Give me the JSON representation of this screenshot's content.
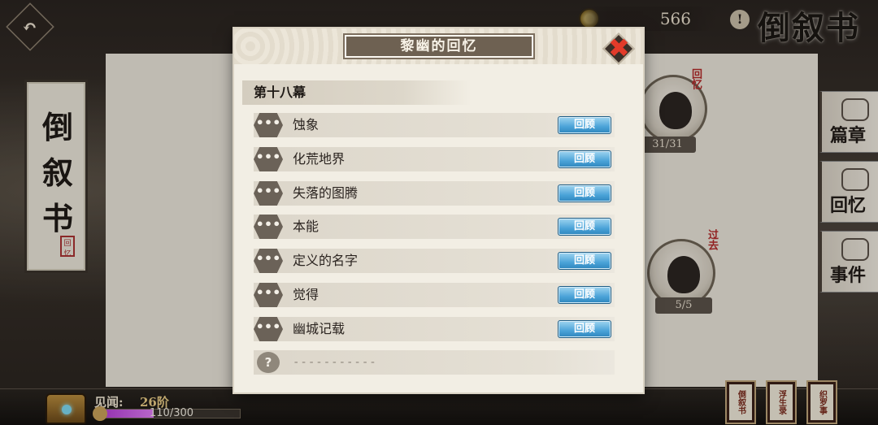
{
  "top_bar": {
    "currency_value": "566",
    "title": "倒叙书"
  },
  "book_spine": {
    "title_chars": [
      "倒",
      "叙",
      "书"
    ],
    "seal": "回忆"
  },
  "side_entries": [
    {
      "count": "31/31",
      "mark": "回忆"
    },
    {
      "count": "5/5",
      "mark": "过去"
    }
  ],
  "side_tabs": [
    {
      "label": "篇章"
    },
    {
      "label": "回忆"
    },
    {
      "label": "事件"
    }
  ],
  "bottom_bar": {
    "seen_label": "见闻:",
    "seen_rank": "26阶",
    "exp_text": "110/300",
    "exp_fraction": 0.3667,
    "books": [
      "倒叙书",
      "浮生录",
      "织罗事"
    ]
  },
  "modal": {
    "title": "黎幽的回忆",
    "act_header": "第十八幕",
    "review_label": "回顾",
    "entries": [
      {
        "label": "蚀象",
        "unlocked": true
      },
      {
        "label": "化荒地界",
        "unlocked": true
      },
      {
        "label": "失落的图腾",
        "unlocked": true
      },
      {
        "label": "本能",
        "unlocked": true
      },
      {
        "label": "定义的名字",
        "unlocked": true
      },
      {
        "label": "觉得",
        "unlocked": true
      },
      {
        "label": "幽城记载",
        "unlocked": true
      },
      {
        "label": "-----------",
        "unlocked": false
      }
    ]
  }
}
